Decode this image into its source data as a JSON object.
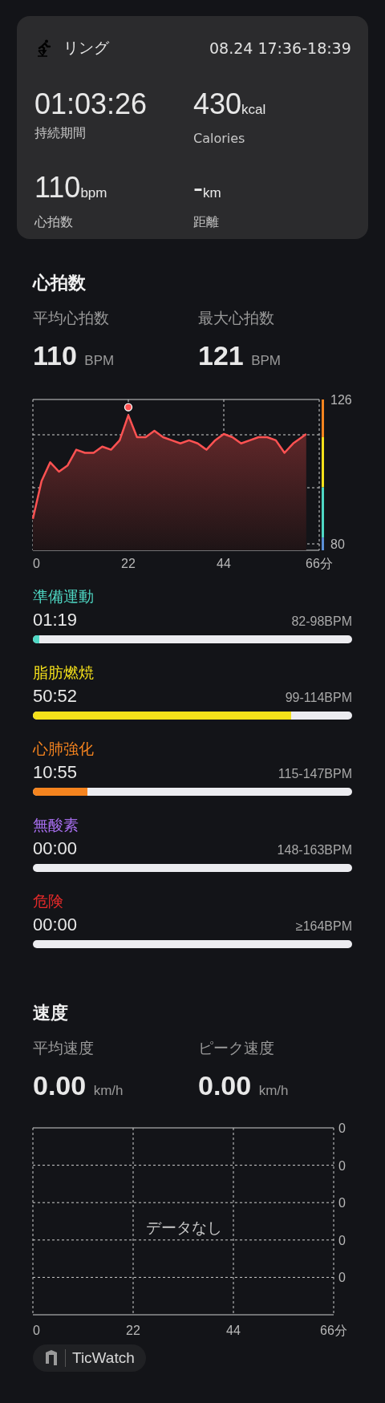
{
  "summary": {
    "title": "リング",
    "time_range": "08.24 17:36-18:39",
    "stats": [
      {
        "value": "01:03:26",
        "label": "持続期間"
      },
      {
        "value": "430",
        "unit": "kcal",
        "label": "Calories"
      },
      {
        "value": "110",
        "unit": "bpm",
        "label": "心拍数"
      },
      {
        "value": "-",
        "unit": "km",
        "label": "距離"
      }
    ]
  },
  "heart_rate": {
    "title": "心拍数",
    "metrics": [
      {
        "label": "平均心拍数",
        "value": "110",
        "unit": "BPM"
      },
      {
        "label": "最大心拍数",
        "value": "121",
        "unit": "BPM"
      }
    ],
    "chart_data": {
      "type": "area",
      "x": [
        0,
        2,
        4,
        6,
        8,
        10,
        12,
        14,
        16,
        18,
        20,
        22,
        24,
        26,
        28,
        30,
        32,
        34,
        36,
        38,
        40,
        42,
        44,
        46,
        48,
        50,
        52,
        54,
        56,
        58,
        60,
        62,
        63
      ],
      "series": [
        {
          "color": "#ff5252",
          "values": [
            88,
            100,
            106,
            103,
            105,
            110,
            109,
            109,
            111,
            110,
            113,
            121,
            114,
            114,
            116,
            114,
            113,
            112,
            113,
            112,
            110,
            113,
            115,
            114,
            112,
            113,
            114,
            114,
            113,
            109,
            112,
            114,
            115
          ]
        }
      ],
      "xlim": [
        0,
        66
      ],
      "ylim": [
        80,
        126
      ],
      "xticks": [
        0,
        22,
        44,
        {
          "value": 66,
          "label": "66分"
        }
      ],
      "yticks": [
        80,
        126
      ]
    }
  },
  "zones": [
    {
      "name": "準備運動",
      "time": "01:19",
      "range": "82-98BPM",
      "level": 0.02,
      "color": "#4fd8c4"
    },
    {
      "name": "脂肪燃焼",
      "time": "50:52",
      "range": "99-114BPM",
      "level": 0.81,
      "color": "#f5e11a"
    },
    {
      "name": "心肺強化",
      "time": "10:55",
      "range": "115-147BPM",
      "level": 0.17,
      "color": "#f5841f"
    },
    {
      "name": "無酸素",
      "time": "00:00",
      "range": "148-163BPM",
      "color": "#a86ff0"
    },
    {
      "name": "危険",
      "time": "00:00",
      "range": "≥164BPM",
      "color": "#e52a2a"
    }
  ],
  "speed": {
    "title": "速度",
    "metrics": [
      {
        "label": "平均速度",
        "value": "0.00",
        "unit": "km/h"
      },
      {
        "label": "ピーク速度",
        "value": "0.00",
        "unit": "km/h"
      }
    ],
    "chart": {
      "empty_text": "データなし",
      "y_labels": [
        "0",
        "0",
        "0",
        "0",
        "0"
      ],
      "x_labels": [
        "0",
        "22",
        "44",
        "66分"
      ]
    }
  },
  "device": {
    "name": "TicWatch"
  }
}
